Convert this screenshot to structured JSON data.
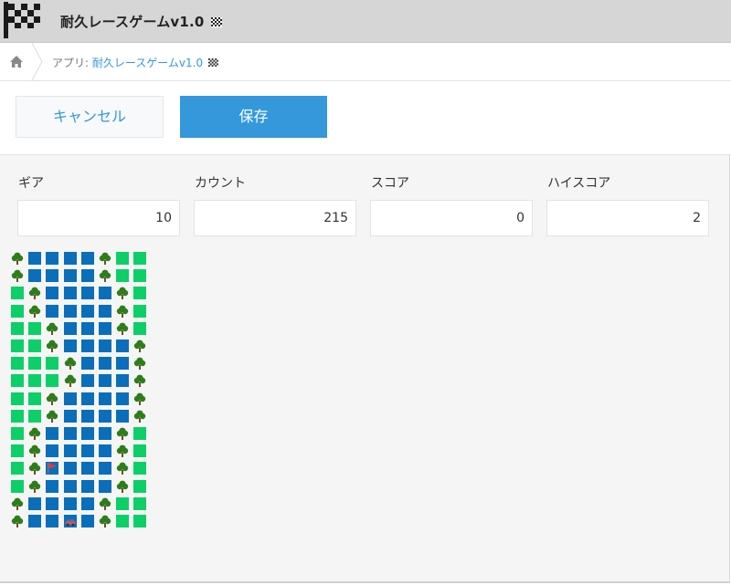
{
  "app": {
    "title": "耐久レースゲームv1.0"
  },
  "breadcrumb": {
    "prefix": "アプリ: ",
    "link": "耐久レースゲームv1.0"
  },
  "toolbar": {
    "cancel_label": "キャンセル",
    "save_label": "保存"
  },
  "fields": [
    {
      "label": "ギア",
      "value": "10"
    },
    {
      "label": "カウント",
      "value": "215"
    },
    {
      "label": "スコア",
      "value": "0"
    },
    {
      "label": "ハイスコア",
      "value": "2"
    }
  ],
  "colors": {
    "accent": "#3498db",
    "road": "#0a6eba",
    "grass": "#0dcf68",
    "tree": "#2e7d1b",
    "flag": "#e53935"
  },
  "board": {
    "legend": {
      "R": "road",
      "G": "grass",
      "T": "tree",
      "F": "flag",
      "C": "car"
    },
    "rows": [
      "TRRRRTGG",
      "TRRRRTGG",
      "GTRRRRTG",
      "GTRRRRTG",
      "GGTRRRTG",
      "GGTRRRRT",
      "GGGTRRRT",
      "GGGTRRRT",
      "GGTRRRRT",
      "GGTRRRRT",
      "GTRRRRTG",
      "GTRRRRTG",
      "GTFRRRTG",
      "GTRRRRTG",
      "TRRRRTGG",
      "TRRCRTGG"
    ]
  }
}
